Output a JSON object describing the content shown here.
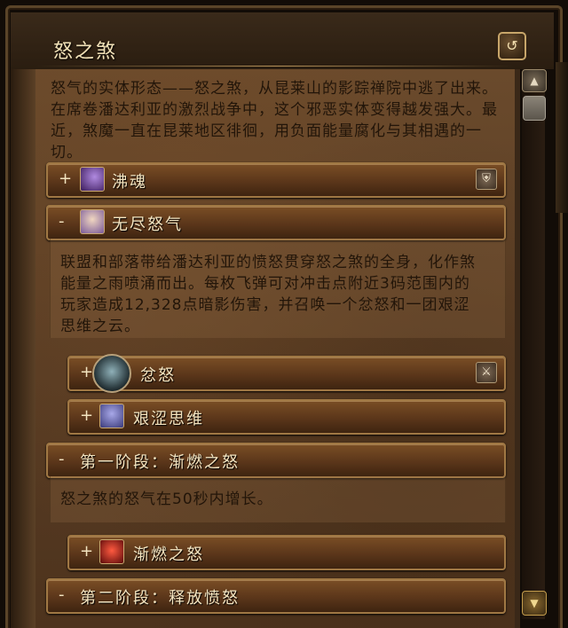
{
  "window": {
    "title": "怒之煞"
  },
  "header": {
    "reset_icon": "undo-arrow-icon"
  },
  "description": "怒气的实体形态——怒之煞，从昆莱山的影踪禅院中逃了出来。在席卷潘达利亚的激烈战争中，这个邪恶实体变得越发强大。最近，煞魔一直在昆莱地区徘徊，用负面能量腐化与其相遇的一切。",
  "sections": [
    {
      "toggle": "+",
      "label": "沸魂",
      "icon": "purple-staff-icon",
      "badge": "shield-icon"
    },
    {
      "toggle": "-",
      "label": "无尽怒气",
      "icon": "cloaked-figure-icon",
      "detail": "联盟和部落带给潘达利亚的愤怒贯穿怒之煞的全身，化作煞能量之雨喷涌而出。每枚飞弹可对冲击点附近3码范围内的玩家造成12,328点暗影伤害，并召唤一个忿怒和一团艰涩思维之云。"
    },
    {
      "toggle": "+",
      "label": "忿怒",
      "icon": "sha-face-icon",
      "badge": "sword-icon"
    },
    {
      "toggle": "+",
      "label": "艰涩思维",
      "icon": "ghost-face-icon"
    },
    {
      "toggle": "-",
      "label": "第一阶段：渐燃之怒",
      "detail": "怒之煞的怒气在50秒内增长。"
    },
    {
      "toggle": "+",
      "label": "渐燃之怒",
      "icon": "red-demon-face-icon"
    },
    {
      "toggle": "-",
      "label": "第二阶段：释放愤怒"
    }
  ]
}
